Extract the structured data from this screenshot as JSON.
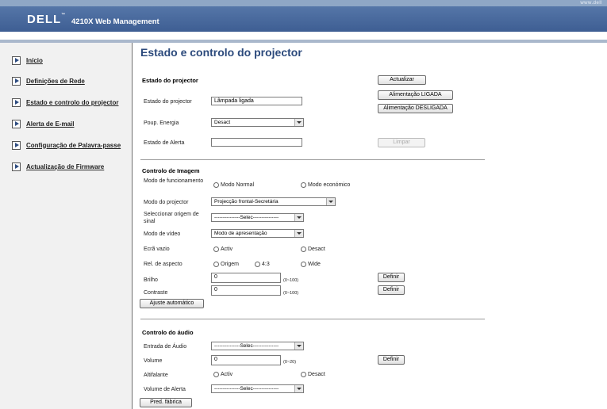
{
  "header": {
    "url_text": "www.dell",
    "logo": "DELL",
    "logo_tm": "™",
    "app_title": "4210X Web Management"
  },
  "sidebar": {
    "items": [
      {
        "label": "Início"
      },
      {
        "label": "Definições de Rede"
      },
      {
        "label": "Estado e controlo do projector"
      },
      {
        "label": "Alerta de E-mail"
      },
      {
        "label": "Configuração de Palavra-passe"
      },
      {
        "label": "Actualização de Firmware"
      }
    ]
  },
  "main": {
    "title": "Estado e controlo do projector",
    "status": {
      "section_title": "Estado do projector",
      "refresh_label": "Actualizar",
      "power_on_label": "Alimentação LIGADA",
      "power_off_label": "Alimentação DESLIGADA",
      "projector_state_label": "Estado do projector",
      "projector_state_value": "Lâmpada ligada",
      "power_save_label": "Poup. Energia",
      "power_save_value": "Desact",
      "alert_state_label": "Estado de Alerta",
      "alert_state_value": "",
      "clear_label": "Limpar"
    },
    "image": {
      "section_title": "Controlo de Imagem",
      "mode_label": "Modo de funcionamento",
      "mode_normal": "Modo Normal",
      "mode_eco": "Modo económico",
      "projector_mode_label": "Modo do projector",
      "projector_mode_value": "Projecção frontal-Secretária",
      "source_label": "Seleccionar origem de sinal",
      "source_value": "---------------Selec---------------",
      "video_mode_label": "Modo de vídeo",
      "video_mode_value": "Modo de apresentação",
      "blank_label": "Ecrã vazio",
      "blank_on": "Activ",
      "blank_off": "Desact",
      "aspect_label": "Rel. de aspecto",
      "aspect_origin": "Origem",
      "aspect_43": "4:3",
      "aspect_wide": "Wide",
      "brightness_label": "Brilho",
      "brightness_value": "0",
      "brightness_range": "(0~100)",
      "contrast_label": "Contraste",
      "contrast_value": "0",
      "contrast_range": "(0~100)",
      "define_label": "Definir",
      "auto_adjust_label": "Ajuste automático"
    },
    "audio": {
      "section_title": "Controlo do áudio",
      "input_label": "Entrada de Áudio",
      "input_value": "---------------Selec---------------",
      "volume_label": "Volume",
      "volume_value": "0",
      "volume_range": "(0~20)",
      "define_label": "Definir",
      "speaker_label": "Altifalante",
      "speaker_on": "Activ",
      "speaker_off": "Desact",
      "alert_volume_label": "Volume de Alerta",
      "alert_volume_value": "---------------Selec---------------",
      "factory_label": "Pred. fábrica"
    }
  }
}
